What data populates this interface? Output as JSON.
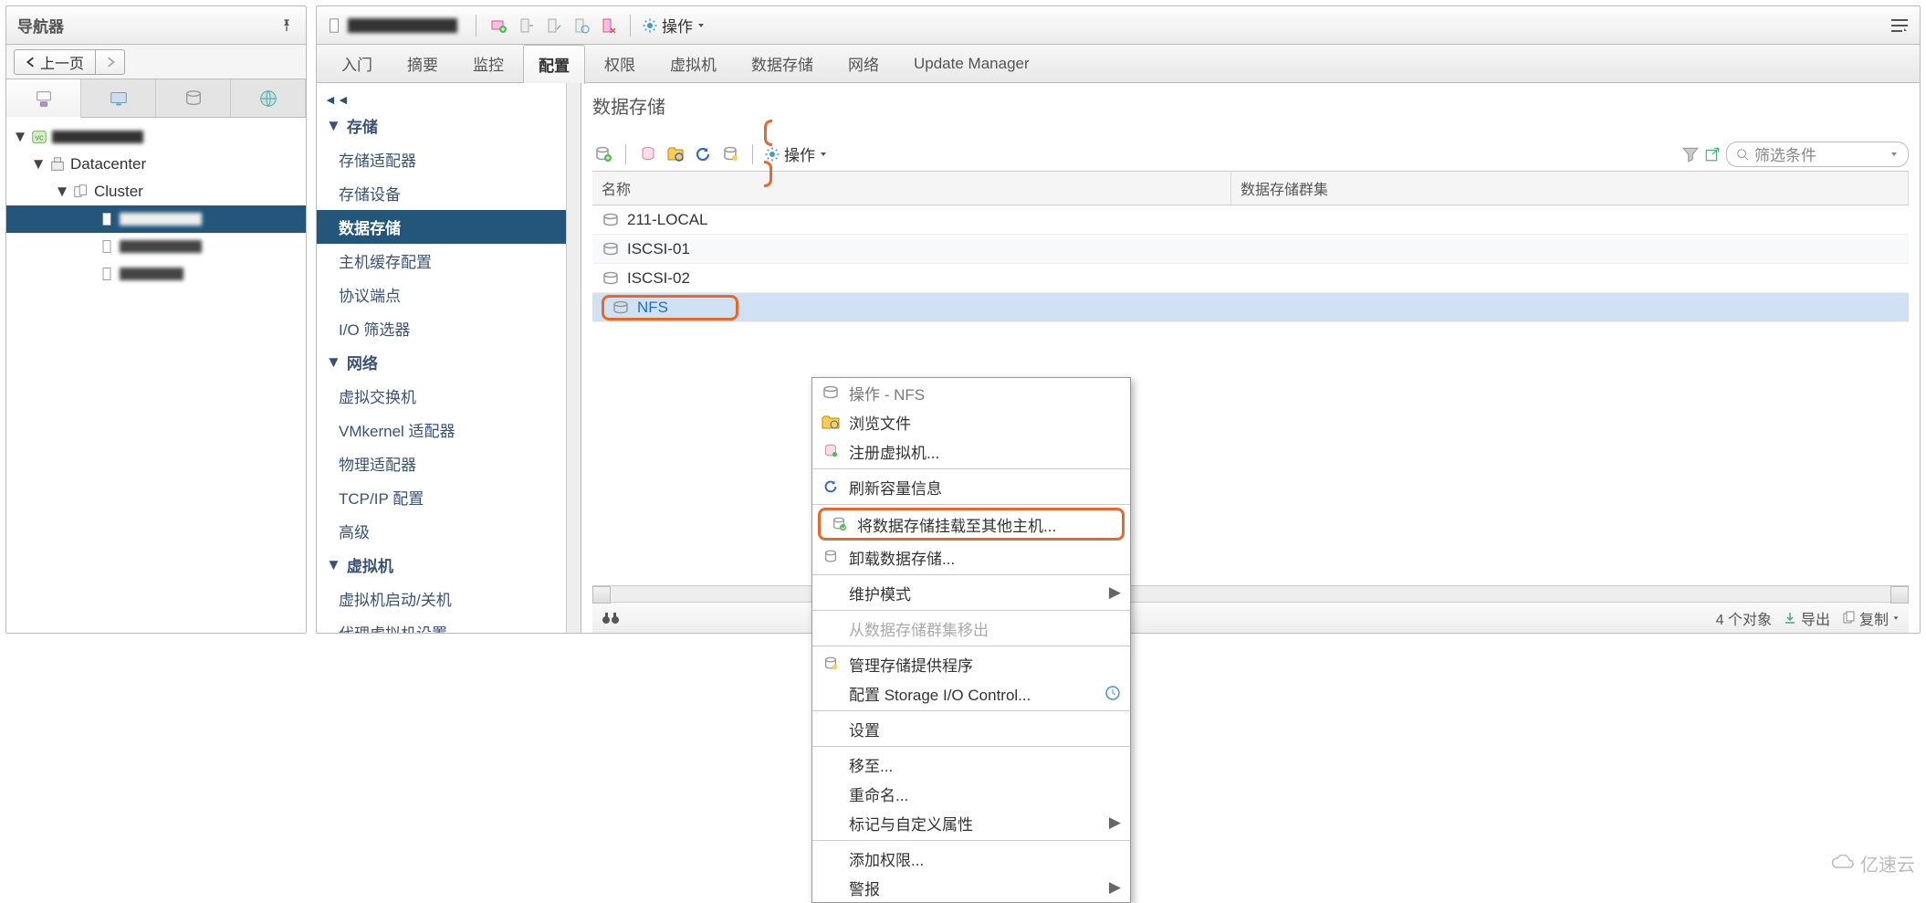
{
  "navigator": {
    "title": "导航器",
    "back_label": "上一页",
    "tree": {
      "root": "",
      "datacenter": "Datacenter",
      "cluster": "Cluster",
      "hosts": [
        "",
        "",
        ""
      ]
    }
  },
  "host_bar": {
    "title": "",
    "actions": "操作"
  },
  "main_tabs": [
    "入门",
    "摘要",
    "监控",
    "配置",
    "权限",
    "虚拟机",
    "数据存储",
    "网络",
    "Update Manager"
  ],
  "active_main_tab": "配置",
  "sidebar": {
    "cat_storage": "存储",
    "storage_items": [
      "存储适配器",
      "存储设备",
      "数据存储",
      "主机缓存配置",
      "协议端点",
      "I/O 筛选器"
    ],
    "storage_selected": "数据存储",
    "cat_network": "网络",
    "network_items": [
      "虚拟交换机",
      "VMkernel 适配器",
      "物理适配器",
      "TCP/IP 配置",
      "高级"
    ],
    "cat_vm": "虚拟机",
    "vm_items": [
      "虚拟机启动/关机",
      "代理虚拟机设置"
    ]
  },
  "content": {
    "title": "数据存储",
    "toolbar": {
      "actions": "操作",
      "filter_placeholder": "筛选条件"
    },
    "columns": {
      "name": "名称",
      "cluster": "数据存储群集"
    },
    "rows": [
      "211-LOCAL",
      "ISCSI-01",
      "ISCSI-02",
      "NFS"
    ],
    "selected_row": "NFS"
  },
  "ctx": {
    "header": "操作 - NFS",
    "browse": "浏览文件",
    "register": "注册虚拟机...",
    "refresh": "刷新容量信息",
    "mount": "将数据存储挂载至其他主机...",
    "unmount": "卸载数据存储...",
    "maint": "维护模式",
    "remove_cluster": "从数据存储群集移出",
    "manage_provider": "管理存储提供程序",
    "sioc": "配置 Storage I/O Control...",
    "settings": "设置",
    "move": "移至...",
    "rename": "重命名...",
    "tags": "标记与自定义属性",
    "perm": "添加权限...",
    "alarm": "警报"
  },
  "status": {
    "count": "4 个对象",
    "export": "导出",
    "copy": "复制"
  },
  "watermark": "亿速云"
}
